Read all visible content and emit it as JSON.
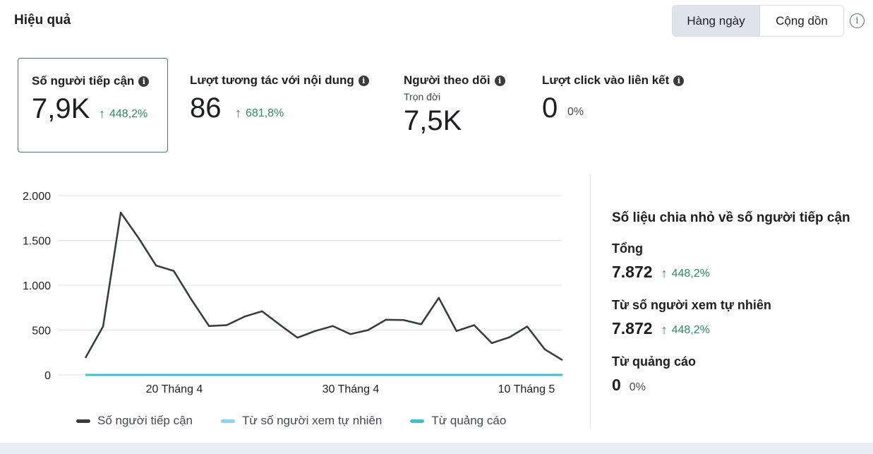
{
  "header": {
    "title": "Hiệu quả",
    "toggle": [
      "Hàng ngày",
      "Cộng dồn"
    ],
    "info_icon": "info-icon"
  },
  "metrics": [
    {
      "label": "Số người tiếp cận",
      "value": "7,9K",
      "change": "448,2%",
      "trend": "up"
    },
    {
      "label": "Lượt tương tác với nội dung",
      "value": "86",
      "change": "681,8%",
      "trend": "up"
    },
    {
      "label": "Người theo dõi",
      "sub": "Trọn đời",
      "value": "7,5K"
    },
    {
      "label": "Lượt click vào liên kết",
      "value": "0",
      "change": "0%",
      "trend": "none"
    }
  ],
  "chart_data": {
    "type": "line",
    "x_ticks": [
      "20 Tháng 4",
      "30 Tháng 4",
      "10 Tháng 5"
    ],
    "y_ticks": [
      "2.000",
      "1.500",
      "1.000",
      "500",
      "0"
    ],
    "ylim": [
      0,
      2000
    ],
    "grid": true,
    "legend_position": "bottom",
    "series": [
      {
        "name": "Số người tiếp cận",
        "color": "#3a3b3c",
        "values": [
          190,
          540,
          1810,
          1530,
          1220,
          1160,
          840,
          545,
          555,
          650,
          710,
          560,
          415,
          490,
          545,
          455,
          500,
          615,
          612,
          565,
          860,
          490,
          555,
          355,
          420,
          540,
          285,
          165
        ]
      },
      {
        "name": "Từ số người xem tự nhiên",
        "color": "#8fd0f5",
        "values": [
          190,
          540,
          1810,
          1530,
          1220,
          1160,
          840,
          545,
          555,
          650,
          710,
          560,
          415,
          490,
          545,
          455,
          500,
          615,
          612,
          565,
          860,
          490,
          555,
          355,
          420,
          540,
          285,
          165
        ]
      },
      {
        "name": "Từ quảng cáo",
        "color": "#3fc1cc",
        "values": [
          0,
          0,
          0,
          0,
          0,
          0,
          0,
          0,
          0,
          0,
          0,
          0,
          0,
          0,
          0,
          0,
          0,
          0,
          0,
          0,
          0,
          0,
          0,
          0,
          0,
          0,
          0,
          0
        ]
      }
    ]
  },
  "breakdown": {
    "title": "Số liệu chia nhỏ về số người tiếp cận",
    "rows": [
      {
        "label": "Tổng",
        "value": "7.872",
        "change": "448,2%",
        "trend": "up"
      },
      {
        "label": "Từ số người xem tự nhiên",
        "value": "7.872",
        "change": "448,2%",
        "trend": "up"
      },
      {
        "label": "Từ quảng cáo",
        "value": "0",
        "change": "0%",
        "trend": "none"
      }
    ]
  }
}
